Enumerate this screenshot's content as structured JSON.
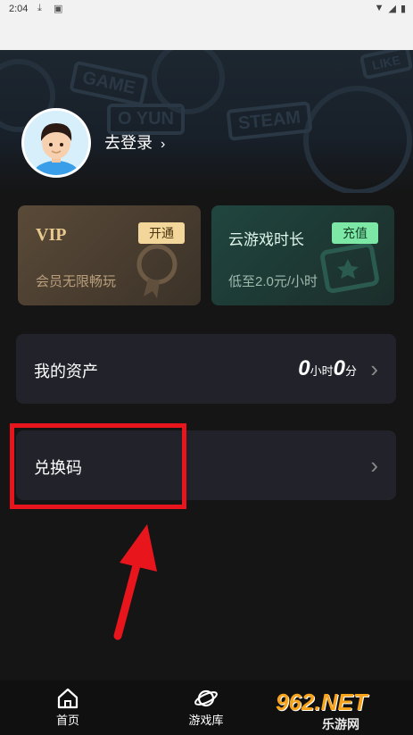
{
  "status_bar": {
    "time": "2:04"
  },
  "profile": {
    "login_text": "去登录",
    "login_chevron": "›"
  },
  "cards": {
    "vip": {
      "title": "VIP",
      "badge": "开通",
      "subtitle": "会员无限畅玩"
    },
    "cloud": {
      "title": "云游戏时长",
      "badge": "充值",
      "subtitle": "低至2.0元/小时"
    }
  },
  "assets_row": {
    "label": "我的资产",
    "hours": "0",
    "hours_unit": "小时",
    "minutes": "0",
    "minutes_unit": "分"
  },
  "redeem_row": {
    "label": "兑换码"
  },
  "tabs": [
    {
      "label": "首页",
      "icon": "home-icon"
    },
    {
      "label": "游戏库",
      "icon": "planet-icon"
    }
  ],
  "watermark": {
    "text": "962.NET",
    "sub": "乐游网"
  },
  "hero_deco": [
    "GAME",
    "O YUN",
    "STEAM",
    "LIKE"
  ],
  "colors": {
    "highlight": "#e8161c",
    "vip_badge": "#f3d69a",
    "cloud_badge": "#7de7a5"
  }
}
